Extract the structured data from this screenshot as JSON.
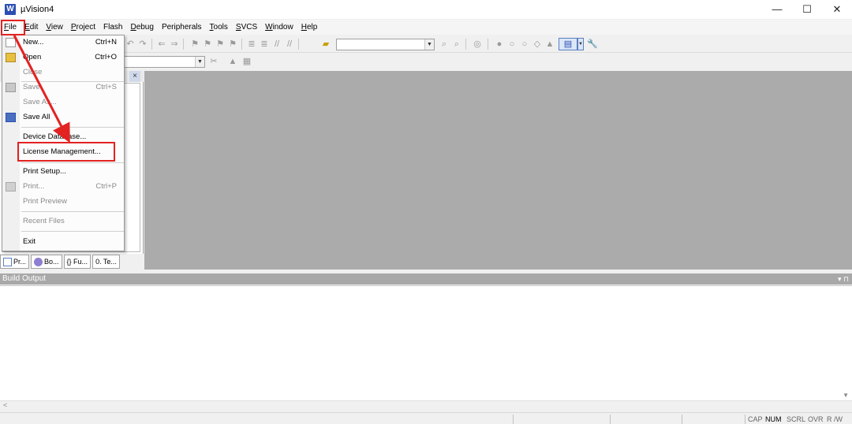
{
  "window": {
    "title": "µVision4",
    "icon_letter": "W",
    "minimize_glyph": "—",
    "maximize_glyph": "☐",
    "close_glyph": "✕"
  },
  "menubar": {
    "items": [
      "File",
      "Edit",
      "View",
      "Project",
      "Flash",
      "Debug",
      "Peripherals",
      "Tools",
      "SVCS",
      "Window",
      "Help"
    ]
  },
  "file_menu": {
    "new": {
      "label": "New...",
      "shortcut": "Ctrl+N"
    },
    "open": {
      "label": "Open",
      "shortcut": "Ctrl+O"
    },
    "close": {
      "label": "Close"
    },
    "save": {
      "label": "Save",
      "shortcut": "Ctrl+S"
    },
    "save_as": {
      "label": "Save As..."
    },
    "save_all": {
      "label": "Save All"
    },
    "device_database": {
      "label": "Device Database..."
    },
    "license_management": {
      "label": "License Management..."
    },
    "print_setup": {
      "label": "Print Setup..."
    },
    "print": {
      "label": "Print...",
      "shortcut": "Ctrl+P"
    },
    "print_preview": {
      "label": "Print Preview"
    },
    "recent_files": {
      "label": "Recent Files"
    },
    "exit": {
      "label": "Exit"
    }
  },
  "project_pane": {
    "close_glyph": "×",
    "tabs": [
      "Pr...",
      "Bo...",
      "{} Fu...",
      "0. Te..."
    ]
  },
  "build_output": {
    "title": "Build Output",
    "pin_glyph": "▾ ⊓"
  },
  "statusbar": {
    "indicators": [
      {
        "label": "CAP",
        "active": false
      },
      {
        "label": "NUM",
        "active": true
      },
      {
        "label": "SCRL",
        "active": false
      },
      {
        "label": "OVR",
        "active": false
      },
      {
        "label": "R /W",
        "active": false
      }
    ]
  },
  "annotation_color": "#e32222",
  "workspace_color": "#ababab"
}
